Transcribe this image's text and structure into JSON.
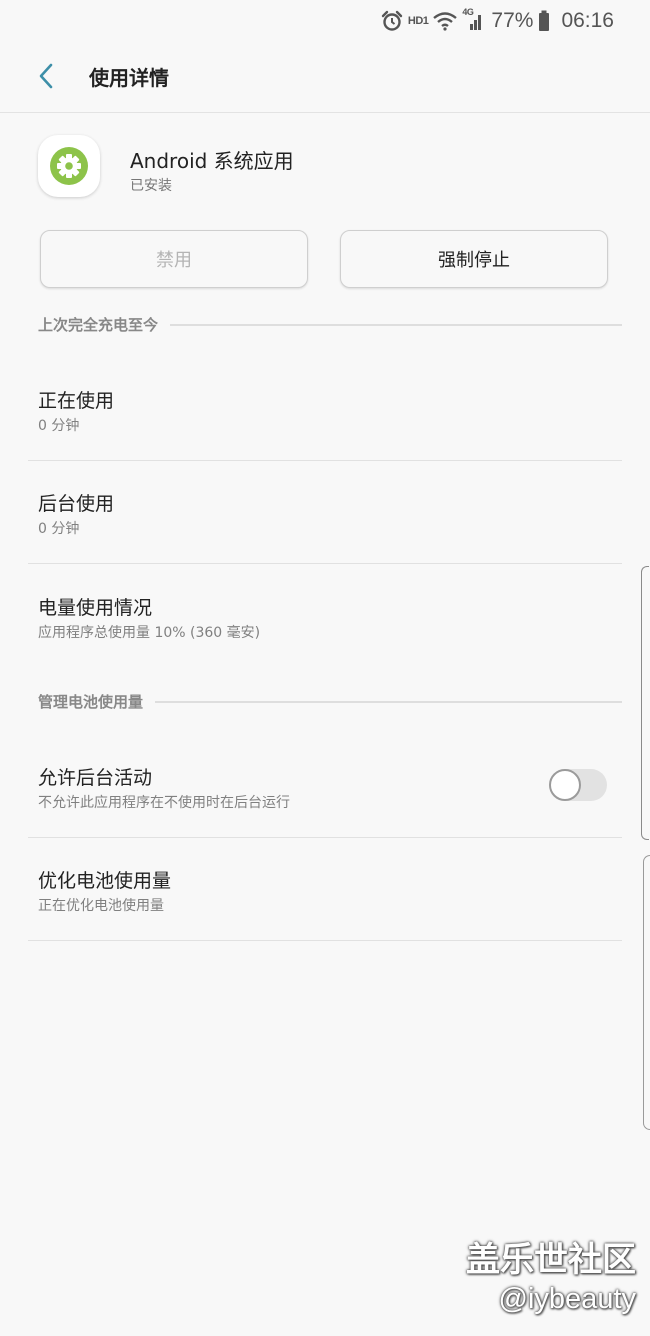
{
  "status_bar": {
    "hd_label": "HD1",
    "network_label": "4G",
    "battery_percent": "77%",
    "time": "06:16",
    "icons": [
      "alarm-icon",
      "wifi-icon",
      "signal-icon",
      "battery-icon"
    ]
  },
  "app_bar": {
    "back_icon": "chevron-left-icon",
    "title": "使用详情"
  },
  "app": {
    "icon": "gear-icon",
    "name": "Android 系统应用",
    "status": "已安装"
  },
  "buttons": {
    "disable": "禁用",
    "force_stop": "强制停止"
  },
  "sections": [
    {
      "header": "上次完全充电至今",
      "items": [
        {
          "title": "正在使用",
          "subtitle": "0 分钟"
        },
        {
          "title": "后台使用",
          "subtitle": "0 分钟"
        },
        {
          "title": "电量使用情况",
          "subtitle": "应用程序总使用量 10% (360 毫安)"
        }
      ]
    },
    {
      "header": "管理电池使用量",
      "items": [
        {
          "title": "允许后台活动",
          "subtitle": "不允许此应用程序在不使用时在后台运行",
          "toggle_on": false
        },
        {
          "title": "优化电池使用量",
          "subtitle": "正在优化电池使用量"
        }
      ]
    }
  ],
  "watermark": {
    "line1": "盖乐世社区",
    "line2": "@iybeauty"
  },
  "colors": {
    "background": "#f8f8f8",
    "accent": "#3d8fa8",
    "app_icon_green": "#8dc34a"
  }
}
